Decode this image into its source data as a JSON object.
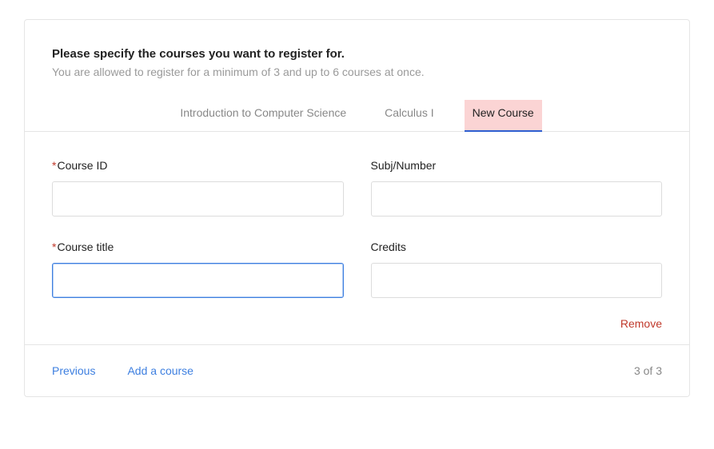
{
  "header": {
    "title": "Please specify the courses you want to register for.",
    "subtitle": "You are allowed to register for a minimum of 3 and up to 6 courses at once."
  },
  "tabs": [
    {
      "label": "Introduction to Computer Science",
      "active": false
    },
    {
      "label": "Calculus I",
      "active": false
    },
    {
      "label": "New Course",
      "active": true
    }
  ],
  "form": {
    "course_id": {
      "label": "Course ID",
      "required": true,
      "value": ""
    },
    "subj_number": {
      "label": "Subj/Number",
      "required": false,
      "value": ""
    },
    "course_title": {
      "label": "Course title",
      "required": true,
      "value": "",
      "focused": true
    },
    "credits": {
      "label": "Credits",
      "required": false,
      "value": ""
    }
  },
  "actions": {
    "remove": "Remove",
    "previous": "Previous",
    "add_course": "Add a course"
  },
  "pager": "3 of 3",
  "required_marker": "*"
}
